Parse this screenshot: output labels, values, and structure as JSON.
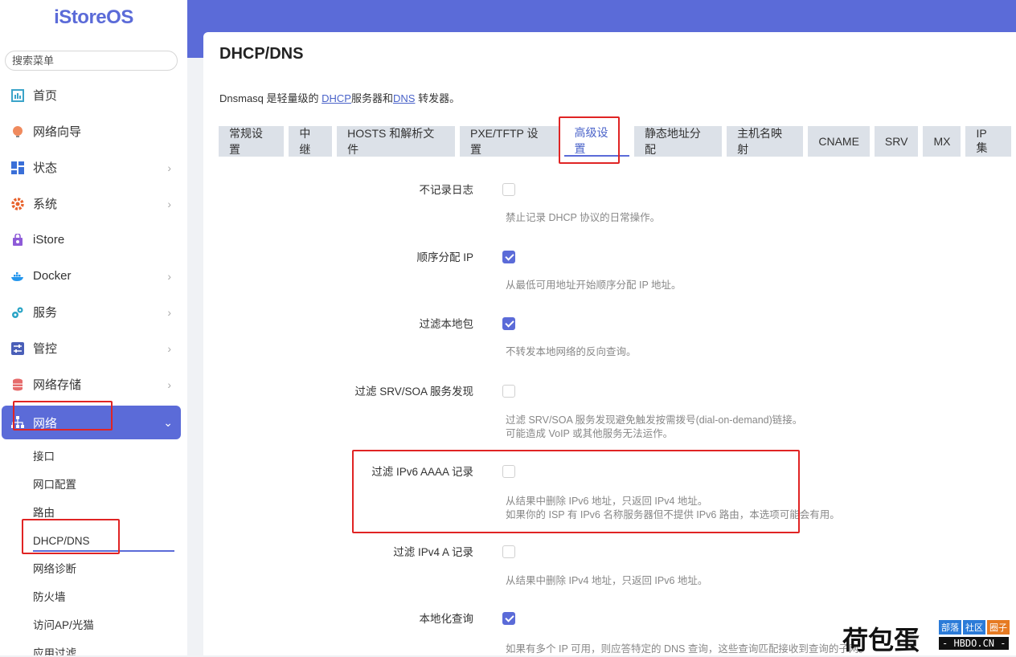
{
  "brand": {
    "logo": "iStoreOS"
  },
  "search": {
    "placeholder": "搜索菜单"
  },
  "nav": {
    "items": [
      {
        "label": "首页"
      },
      {
        "label": "网络向导"
      },
      {
        "label": "状态"
      },
      {
        "label": "系统"
      },
      {
        "label": "iStore"
      },
      {
        "label": "Docker"
      },
      {
        "label": "服务"
      },
      {
        "label": "管控"
      },
      {
        "label": "网络存储"
      },
      {
        "label": "网络"
      }
    ],
    "sub": [
      {
        "label": "接口"
      },
      {
        "label": "网口配置"
      },
      {
        "label": "路由"
      },
      {
        "label": "DHCP/DNS"
      },
      {
        "label": "网络诊断"
      },
      {
        "label": "防火墙"
      },
      {
        "label": "访问AP/光猫"
      },
      {
        "label": "应用过滤"
      }
    ]
  },
  "page": {
    "title": "DHCP/DNS",
    "desc_pre": "Dnsmasq 是轻量级的 ",
    "desc_link1": "DHCP",
    "desc_mid": "服务器和",
    "desc_link2": "DNS",
    "desc_post": " 转发器。"
  },
  "tabs": [
    "常规设置",
    "中继",
    "HOSTS 和解析文件",
    "PXE/TFTP 设置",
    "高级设置",
    "静态地址分配",
    "主机名映射",
    "CNAME",
    "SRV",
    "MX",
    "IP 集"
  ],
  "options": [
    {
      "label": "不记录日志",
      "checked": false,
      "help1": "禁止记录 DHCP 协议的日常操作。",
      "help2": ""
    },
    {
      "label": "顺序分配 IP",
      "checked": true,
      "help1": "从最低可用地址开始顺序分配 IP 地址。",
      "help2": ""
    },
    {
      "label": "过滤本地包",
      "checked": true,
      "help1": "不转发本地网络的反向查询。",
      "help2": ""
    },
    {
      "label": "过滤 SRV/SOA 服务发现",
      "checked": false,
      "help1": "过滤 SRV/SOA 服务发现避免触发按需拨号(dial-on-demand)链接。",
      "help2": "可能造成 VoIP 或其他服务无法运作。"
    },
    {
      "label": "过滤 IPv6 AAAA 记录",
      "checked": false,
      "help1": "从结果中删除 IPv6 地址，只返回 IPv4 地址。",
      "help2": "如果你的 ISP 有 IPv6 名称服务器但不提供 IPv6 路由，本选项可能会有用。"
    },
    {
      "label": "过滤 IPv4 A 记录",
      "checked": false,
      "help1": "从结果中删除 IPv4 地址，只返回 IPv6 地址。",
      "help2": ""
    },
    {
      "label": "本地化查询",
      "checked": true,
      "help1": "如果有多个 IP 可用，则应答特定的 DNS 查询，这些查询匹配接收到查询的子网。",
      "help2": ""
    }
  ],
  "watermark": {
    "big": "荷包蛋",
    "tag1": "部落",
    "tag2": "社区",
    "tag3": "圈子",
    "url": "- HBDO.CN -"
  },
  "colors": {
    "accent": "#5b6bd8",
    "highlight": "#e02424"
  }
}
